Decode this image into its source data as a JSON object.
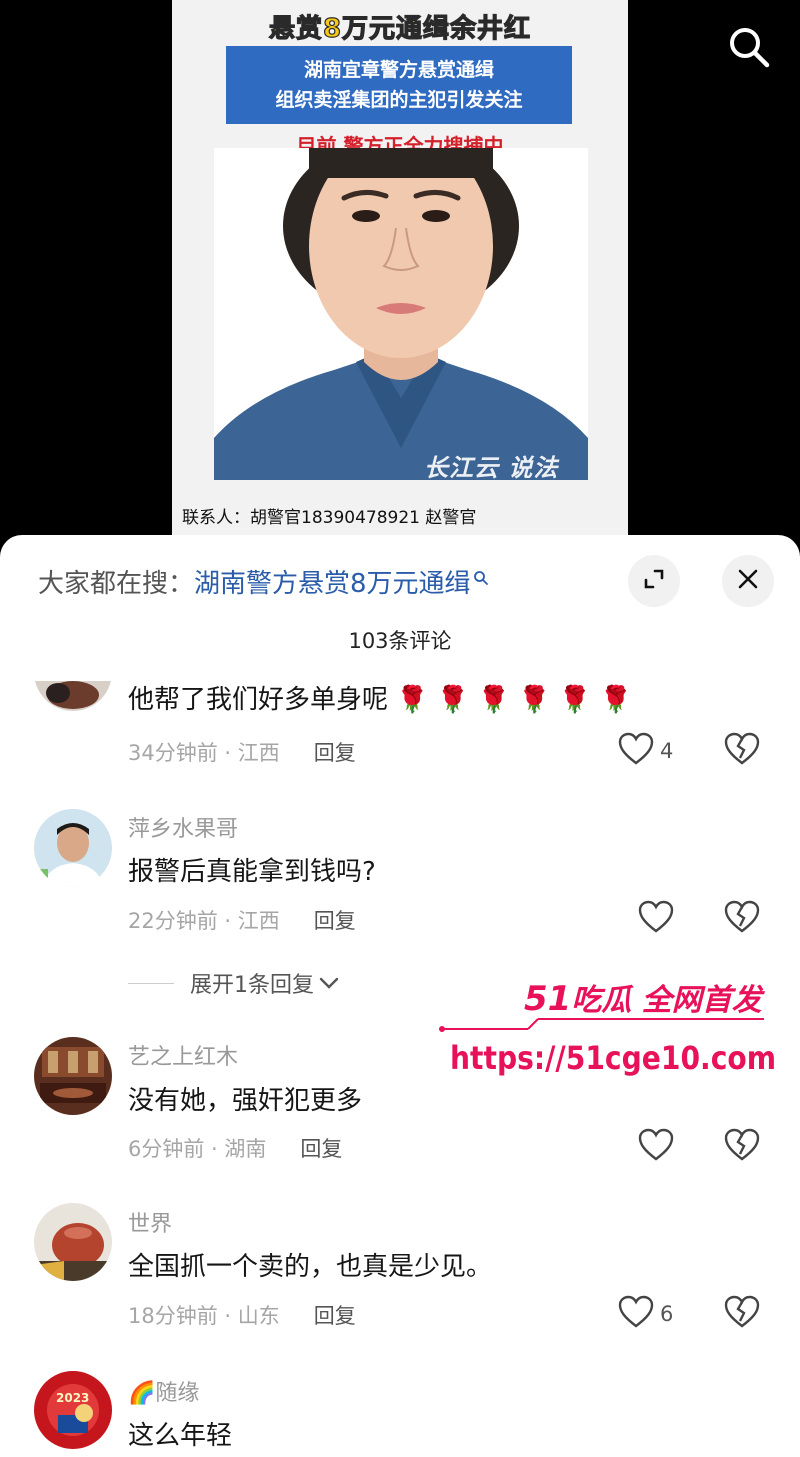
{
  "poster": {
    "headline": "悬赏8万元通缉余井红",
    "banner_line1": "湖南宜章警方悬赏通缉",
    "banner_line2": "组织卖淫集团的主犯引发关注",
    "subline": "目前 警方正全力搜捕中",
    "watermark": "长江云 说法",
    "contact": "联系人：胡警官18390478921 赵警官"
  },
  "search_icon": "search-icon",
  "sheet": {
    "search_prefix": "大家都在搜：",
    "search_query": "湖南警方悬赏8万元通缉",
    "comment_count": "103条评论",
    "expand_icon": "expand-icon",
    "close_icon": "close-icon"
  },
  "comments": [
    {
      "user": "",
      "text": "他帮了我们好多单身呢",
      "emoji": "🌹 🌹 🌹 🌹 🌹 🌹",
      "time": "34分钟前",
      "location": "江西",
      "reply": "回复",
      "likes": "4"
    },
    {
      "user": "萍乡水果哥",
      "text": "报警后真能拿到钱吗?",
      "time": "22分钟前",
      "location": "江西",
      "reply": "回复",
      "likes": ""
    },
    {
      "user": "艺之上红木",
      "text": "没有她，强奸犯更多",
      "time": "6分钟前",
      "location": "湖南",
      "reply": "回复",
      "likes": ""
    },
    {
      "user": "世界",
      "text": "全国抓一个卖的，也真是少见。",
      "time": "18分钟前",
      "location": "山东",
      "reply": "回复",
      "likes": "6"
    },
    {
      "user": "🌈随缘",
      "text": "这么年轻",
      "time": "",
      "location": "",
      "reply": "",
      "likes": ""
    }
  ],
  "expand_replies": "展开1条回复",
  "avatar5_text": "2023",
  "promo": {
    "title_num": "51",
    "title_text": "吃瓜 全网首发",
    "url": "https://51cge10.com"
  },
  "colors": {
    "link_blue": "#2a5caa",
    "promo_pink": "#e8125a",
    "poster_yellow": "#f7c71a",
    "banner_blue": "#2f6bc1",
    "alert_red": "#d4202a"
  }
}
